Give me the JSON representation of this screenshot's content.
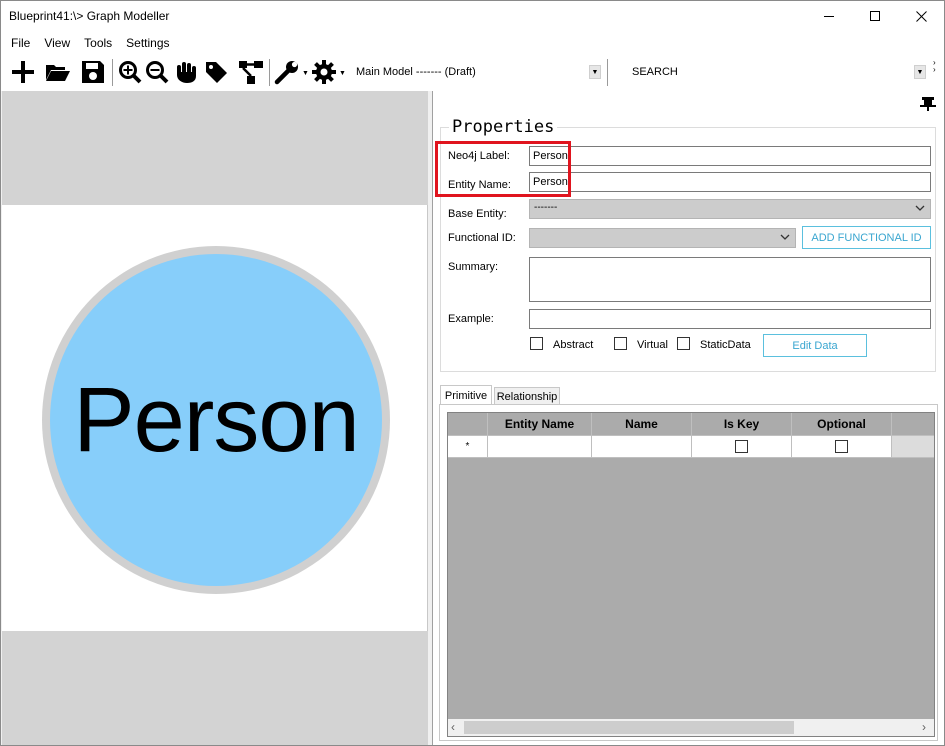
{
  "window": {
    "title": "Blueprint41:\\> Graph Modeller"
  },
  "menu": {
    "items": [
      "File",
      "View",
      "Tools",
      "Settings"
    ]
  },
  "toolbar": {
    "icons": [
      "add-icon",
      "open-folder-icon",
      "save-icon",
      "zoom-in-icon",
      "zoom-out-icon",
      "pan-hand-icon",
      "tag-icon",
      "hierarchy-icon",
      "wrench-icon",
      "gear-icon"
    ],
    "model_select": "Main Model ------- (Draft)",
    "search": "SEARCH"
  },
  "canvas": {
    "node_label": "Person",
    "node_color": "#87cefa",
    "ring_color": "#d0d0d0",
    "band_color": "#d3d3d3"
  },
  "properties": {
    "title": "Properties",
    "neo4j_label": {
      "label": "Neo4j Label:",
      "value": "Person"
    },
    "entity_name": {
      "label": "Entity Name:",
      "value": "Person"
    },
    "base_entity": {
      "label": "Base Entity:",
      "value": "-------"
    },
    "functional_id": {
      "label": "Functional ID:",
      "value": ""
    },
    "add_functional_id_button": "ADD FUNCTIONAL ID",
    "summary": {
      "label": "Summary:",
      "value": ""
    },
    "example": {
      "label": "Example:",
      "value": ""
    },
    "checkboxes": [
      {
        "label": "Abstract",
        "checked": false
      },
      {
        "label": "Virtual",
        "checked": false
      },
      {
        "label": "StaticData",
        "checked": false
      }
    ],
    "edit_data_button": "Edit Data",
    "accent_color": "#5bc0de",
    "highlight_color": "#e0141e"
  },
  "tabs": [
    {
      "label": "Primitive",
      "active": true
    },
    {
      "label": "Relationship",
      "active": false
    }
  ],
  "grid": {
    "columns": [
      "Entity Name",
      "Name",
      "Is Key",
      "Optional"
    ],
    "new_row_marker": "*"
  }
}
